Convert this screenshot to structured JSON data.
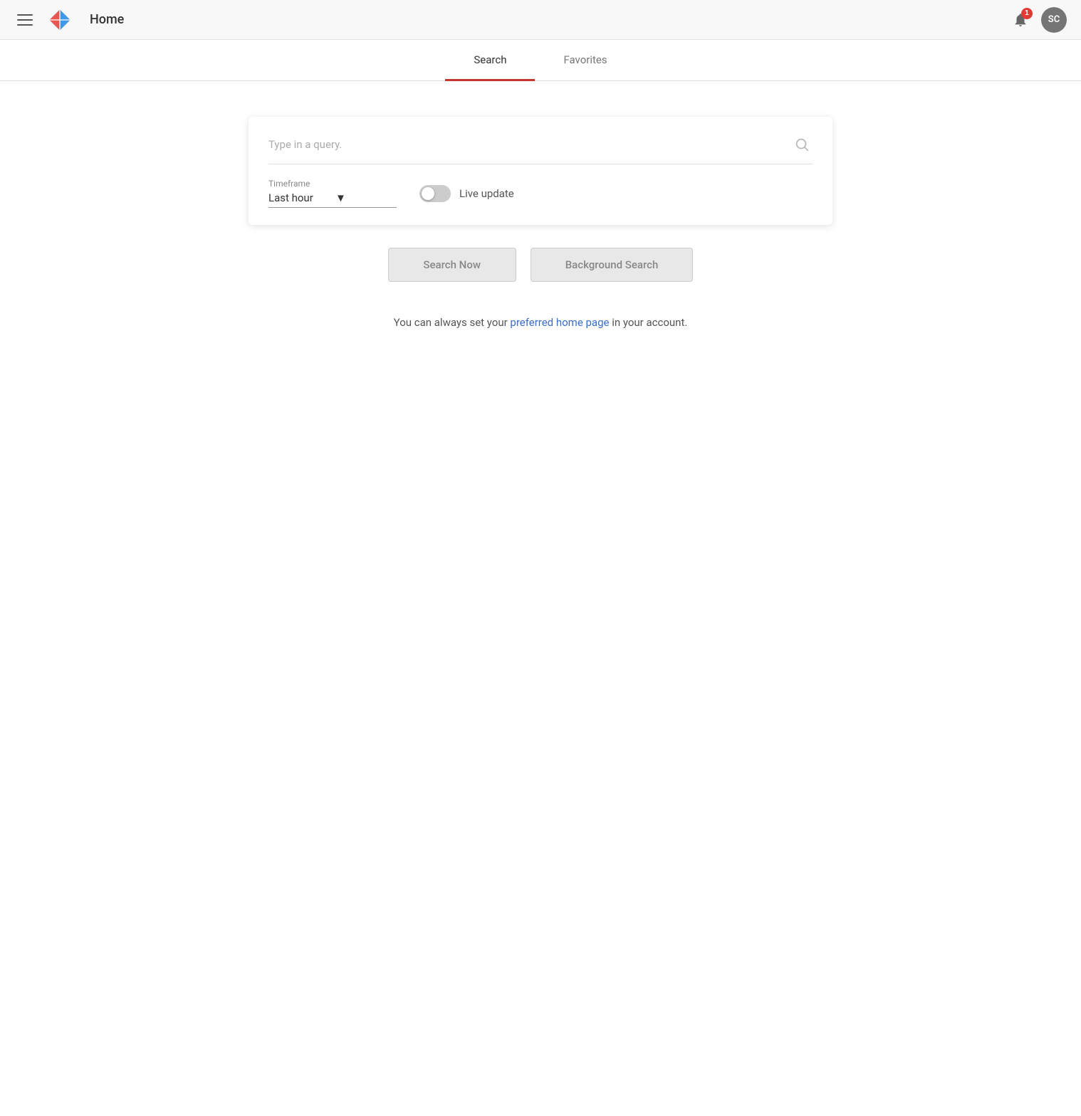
{
  "header": {
    "title": "Home",
    "notification_count": "1",
    "avatar_initials": "SC"
  },
  "tabs": [
    {
      "id": "search",
      "label": "Search",
      "active": true
    },
    {
      "id": "favorites",
      "label": "Favorites",
      "active": false
    }
  ],
  "search_card": {
    "input_placeholder": "Type in a query.",
    "timeframe_label": "Timeframe",
    "timeframe_value": "Last hour",
    "live_update_label": "Live update"
  },
  "buttons": {
    "search_now": "Search Now",
    "background_search": "Background Search"
  },
  "hint": {
    "text_before": "You can always set your ",
    "link_text": "preferred home page",
    "text_after": " in your account."
  },
  "icons": {
    "hamburger": "menu-icon",
    "search": "search-icon",
    "notification": "notification-icon",
    "chevron_down": "chevron-down-icon"
  }
}
